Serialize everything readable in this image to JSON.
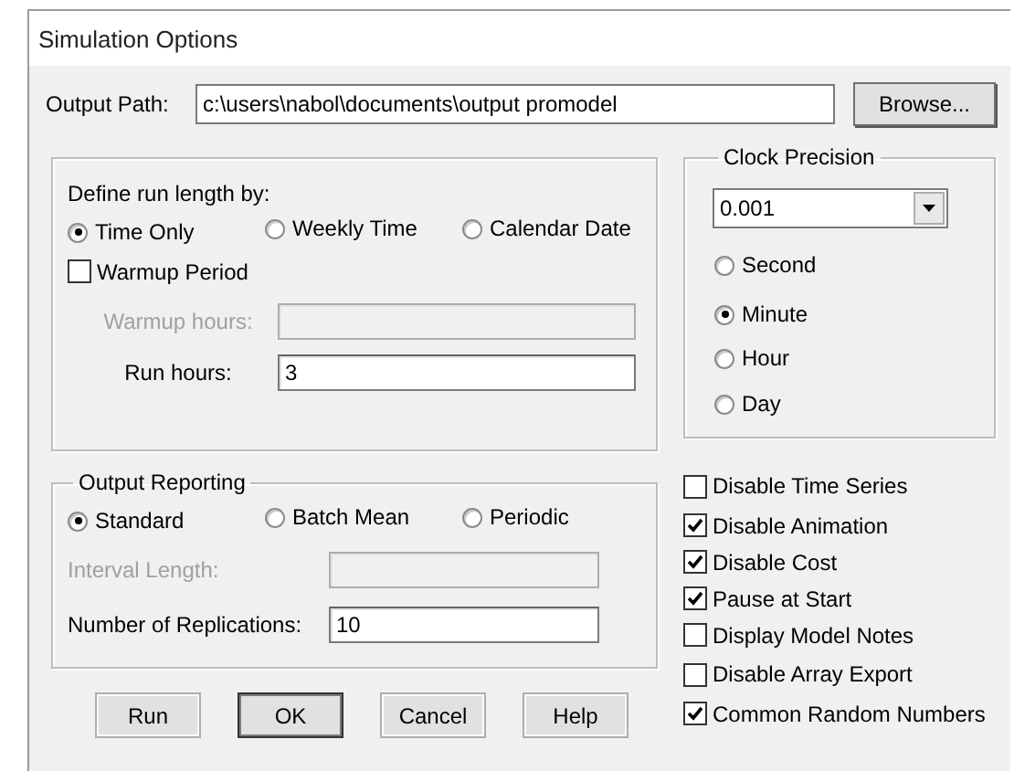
{
  "window": {
    "title": "Simulation Options"
  },
  "output_path": {
    "label": "Output Path:",
    "value": "c:\\users\\nabol\\documents\\output promodel",
    "button": "Browse..."
  },
  "run_length": {
    "title": "Define run length by:",
    "options": [
      {
        "label": "Time Only",
        "selected": true
      },
      {
        "label": "Weekly Time",
        "selected": false
      },
      {
        "label": "Calendar Date",
        "selected": false
      }
    ],
    "warmup": {
      "label": "Warmup Period",
      "checked": false
    },
    "fields": [
      {
        "label": "Warmup hours:",
        "disabled": true
      },
      {
        "label": "Run hours:",
        "value": "3",
        "disabled": false
      }
    ]
  },
  "clock_precision": {
    "title": "Clock Precision",
    "value": "0.001",
    "units": [
      {
        "label": "Second",
        "selected": false
      },
      {
        "label": "Minute",
        "selected": true
      },
      {
        "label": "Hour",
        "selected": false
      },
      {
        "label": "Day",
        "selected": false
      }
    ]
  },
  "output_reporting": {
    "title": "Output Reporting",
    "options": [
      {
        "label": "Standard",
        "selected": true
      },
      {
        "label": "Batch Mean",
        "selected": false
      },
      {
        "label": "Periodic",
        "selected": false
      }
    ],
    "fields": [
      {
        "label": "Interval Length:",
        "disabled": true
      },
      {
        "label": "Number of Replications:",
        "value": "10",
        "disabled": false
      }
    ]
  },
  "options": [
    {
      "label": "Disable Time Series",
      "checked": false
    },
    {
      "label": "Disable Animation",
      "checked": true
    },
    {
      "label": "Disable Cost",
      "checked": true
    },
    {
      "label": "Pause at Start",
      "checked": true
    },
    {
      "label": "Display Model Notes",
      "checked": false
    },
    {
      "label": "Disable Array Export",
      "checked": false
    },
    {
      "label": "Common Random Numbers",
      "checked": true
    }
  ],
  "buttons": [
    {
      "label": "Run",
      "default": false
    },
    {
      "label": "OK",
      "default": true
    },
    {
      "label": "Cancel",
      "default": false
    },
    {
      "label": "Help",
      "default": false
    }
  ]
}
